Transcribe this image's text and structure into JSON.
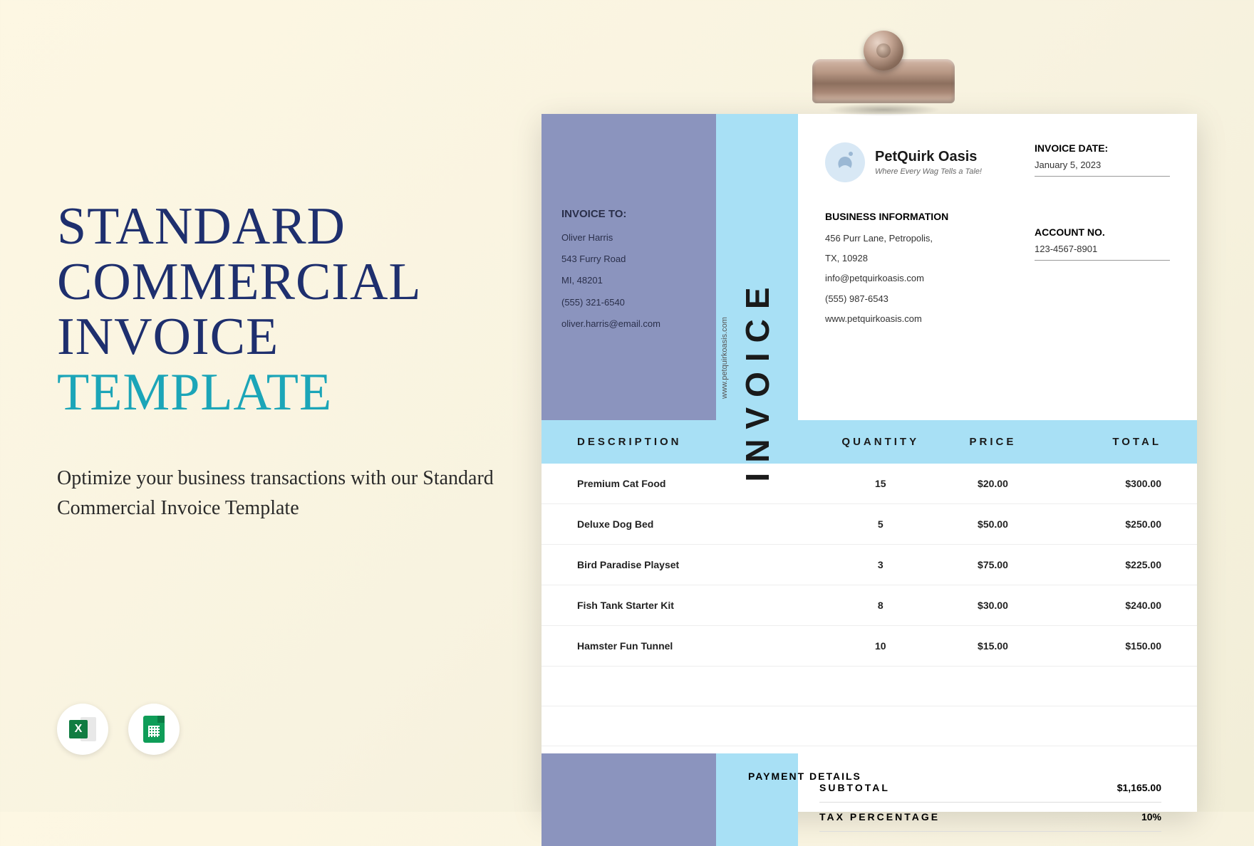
{
  "left": {
    "title_l1": "STANDARD",
    "title_l2": "COMMERCIAL",
    "title_l3": "INVOICE",
    "title_l4": "TEMPLATE",
    "subtitle": "Optimize your business transactions with our Standard Commercial Invoice Template"
  },
  "icons": {
    "excel": "excel-icon",
    "sheets": "google-sheets-icon"
  },
  "invoice": {
    "vertical_label": "INVOICE",
    "url": "www.petquirkoasis.com",
    "to_label": "INVOICE TO:",
    "to": {
      "name": "Oliver Harris",
      "street": "543 Furry Road",
      "city": "MI, 48201",
      "phone": "(555) 321-6540",
      "email": "oliver.harris@email.com"
    },
    "brand": {
      "name": "PetQuirk Oasis",
      "tagline": "Where Every Wag Tells a Tale!"
    },
    "biz_label": "BUSINESS INFORMATION",
    "biz": {
      "street": "456 Purr Lane, Petropolis,",
      "city": "TX, 10928",
      "email": "info@petquirkoasis.com",
      "phone": "(555) 987-6543",
      "web": "www.petquirkoasis.com"
    },
    "date_label": "INVOICE DATE:",
    "date_value": "January 5, 2023",
    "acct_label": "ACCOUNT NO.",
    "acct_value": "123-4567-8901",
    "columns": {
      "desc": "DESCRIPTION",
      "qty": "QUANTITY",
      "price": "PRICE",
      "total": "TOTAL"
    },
    "items": [
      {
        "desc": "Premium Cat Food",
        "qty": "15",
        "price": "$20.00",
        "total": "$300.00"
      },
      {
        "desc": "Deluxe Dog Bed",
        "qty": "5",
        "price": "$50.00",
        "total": "$250.00"
      },
      {
        "desc": "Bird Paradise Playset",
        "qty": "3",
        "price": "$75.00",
        "total": "$225.00"
      },
      {
        "desc": "Fish Tank Starter Kit",
        "qty": "8",
        "price": "$30.00",
        "total": "$240.00"
      },
      {
        "desc": "Hamster Fun Tunnel",
        "qty": "10",
        "price": "$15.00",
        "total": "$150.00"
      }
    ],
    "pay_label": "PAYMENT DETAILS",
    "totals": {
      "subtotal_l": "SUBTOTAL",
      "subtotal_v": "$1,165.00",
      "tax_l": "TAX PERCENTAGE",
      "tax_v": "10%"
    }
  }
}
